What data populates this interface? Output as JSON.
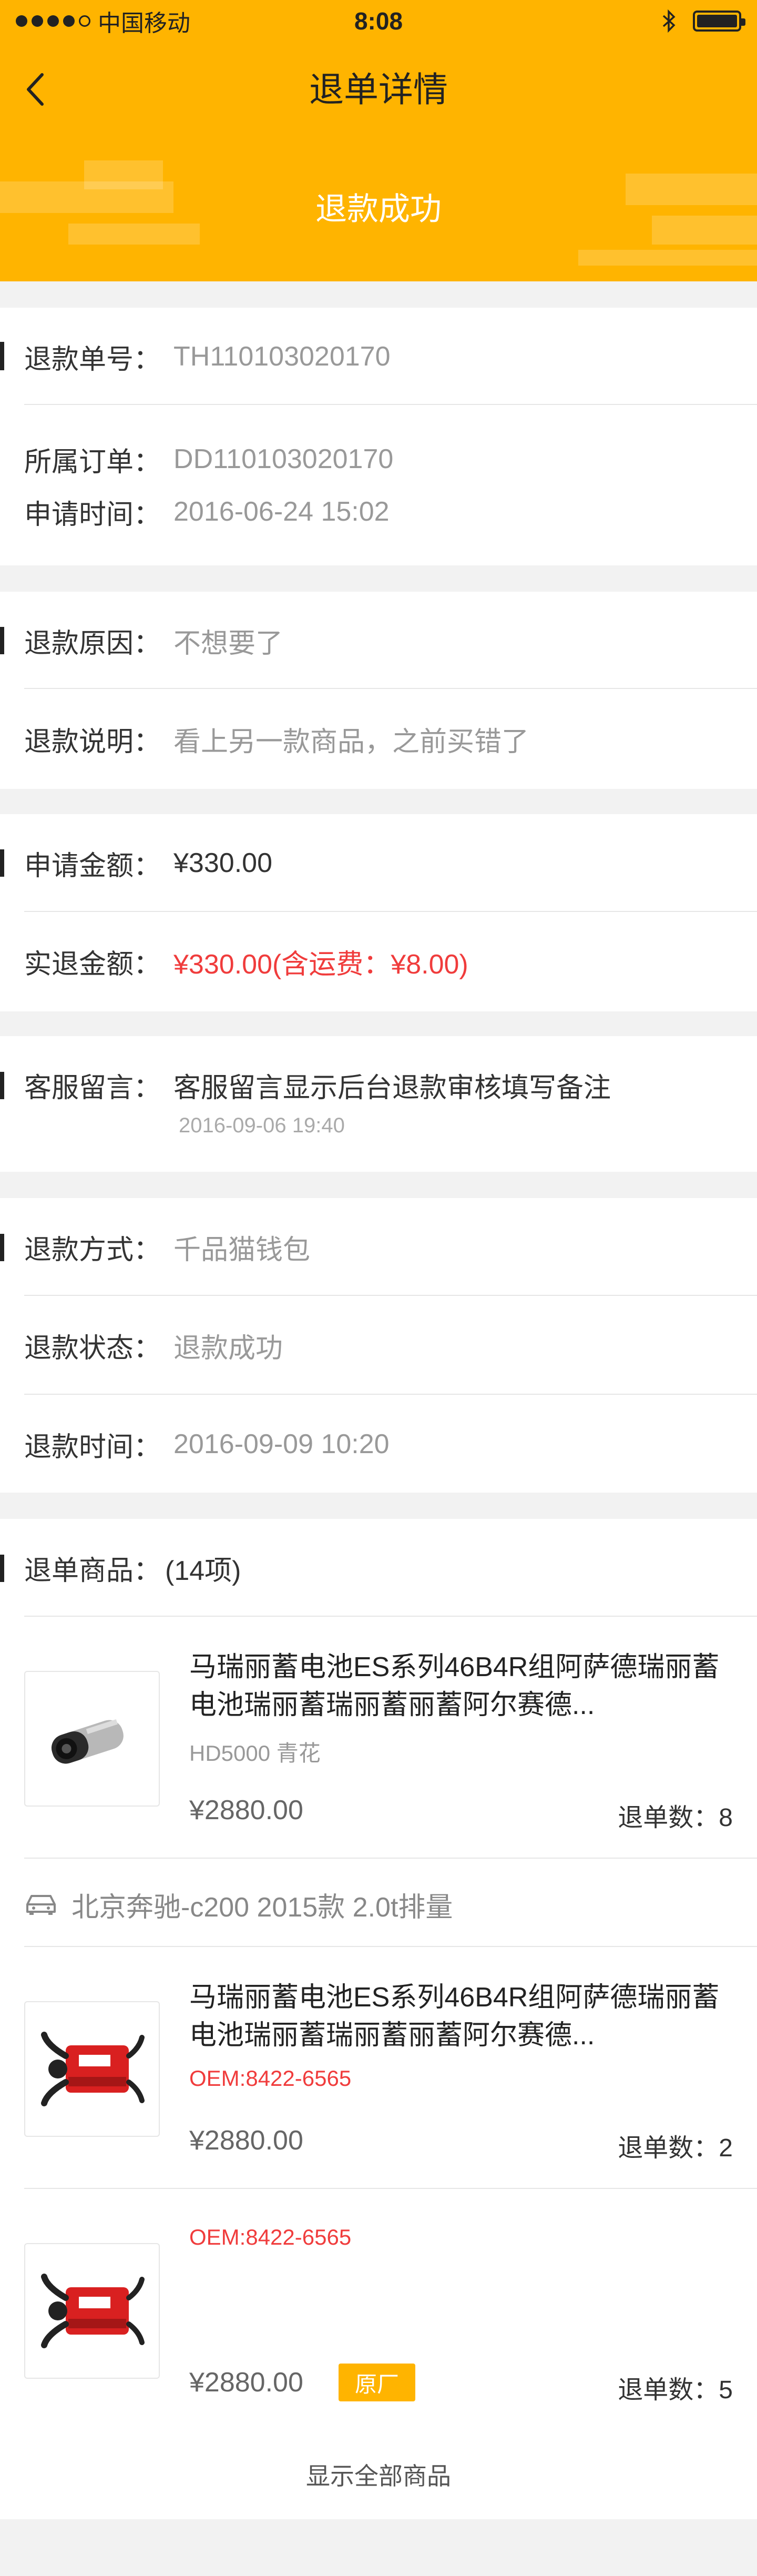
{
  "status_bar": {
    "carrier": "中国移动",
    "time": "8:08",
    "bluetooth_icon": "bluetooth-icon",
    "battery_icon": "battery-icon"
  },
  "nav": {
    "title": "退单详情",
    "back_icon": "chevron-left-icon"
  },
  "banner": {
    "status": "退款成功"
  },
  "refund_info": {
    "refund_no_label": "退款单号：",
    "refund_no": "TH110103020170",
    "order_label": "所属订单：",
    "order_no": "DD110103020170",
    "apply_time_label": "申请时间：",
    "apply_time": "2016-06-24  15:02"
  },
  "reason": {
    "reason_label": "退款原因：",
    "reason_value": "不想要了",
    "desc_label": "退款说明：",
    "desc_value": "看上另一款商品，之前买错了"
  },
  "amount": {
    "apply_label": "申请金额：",
    "apply_value": "¥330.00",
    "actual_label": "实退金额：",
    "actual_value": "¥330.00(含运费：¥8.00)"
  },
  "service_note": {
    "label": "客服留言：",
    "value": "客服留言显示后台退款审核填写备注",
    "time": "2016-09-06 19:40"
  },
  "refund_method": {
    "method_label": "退款方式：",
    "method_value": "千品猫钱包",
    "status_label": "退款状态：",
    "status_value": "退款成功",
    "time_label": "退款时间：",
    "time_value": "2016-09-09 10:20"
  },
  "goods": {
    "label": "退单商品：",
    "count": "(14项)",
    "items": [
      {
        "name": "马瑞丽蓄电池ES系列46B4R组阿萨德瑞丽蓄电池瑞丽蓄瑞丽蓄丽蓄阿尔赛德...",
        "spec": "HD5000   青花",
        "price": "¥2880.00",
        "qty": "退单数：8"
      },
      {
        "name": "马瑞丽蓄电池ES系列46B4R组阿萨德瑞丽蓄电池瑞丽蓄瑞丽蓄丽蓄阿尔赛德...",
        "spec": "OEM:8422-6565",
        "price": "¥2880.00",
        "qty": "退单数：2"
      },
      {
        "spec": "OEM:8422-6565",
        "price": "¥2880.00",
        "tag": "原厂",
        "qty": "退单数：5"
      }
    ],
    "car": "北京奔驰-c200 2015款 2.0t排量",
    "car_icon": "car-icon"
  },
  "footer": {
    "show_all": "显示全部商品"
  },
  "colors": {
    "brand": "#ffb400",
    "price_red": "#f03c3c"
  }
}
